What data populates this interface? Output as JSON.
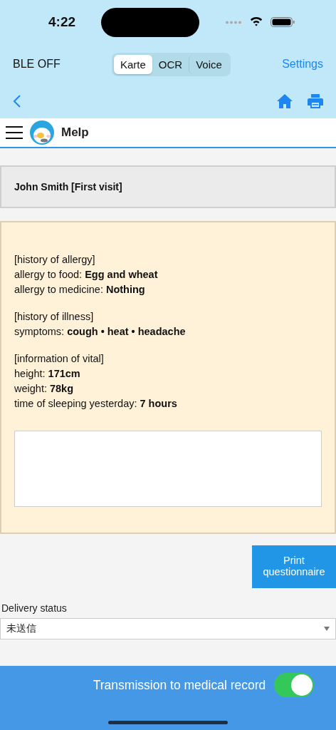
{
  "status_bar": {
    "time": "4:22"
  },
  "nav": {
    "ble_status": "BLE OFF",
    "segments": [
      {
        "label": "Karte",
        "selected": true
      },
      {
        "label": "OCR",
        "selected": false
      },
      {
        "label": "Voice",
        "selected": false
      }
    ],
    "settings": "Settings"
  },
  "header": {
    "app_name": "Melp"
  },
  "patient": {
    "title": "John Smith [First visit]"
  },
  "questionnaire": {
    "sections": [
      {
        "heading": "[history of allergy]",
        "lines": [
          {
            "label": "allergy to food: ",
            "value": "Egg and wheat"
          },
          {
            "label": "allergy to medicine: ",
            "value": "Nothing"
          }
        ]
      },
      {
        "heading": "[history of illness]",
        "lines": [
          {
            "label": "symptoms: ",
            "value": "cough • heat • headache"
          }
        ]
      },
      {
        "heading": "[information of vital]",
        "lines": [
          {
            "label": "height: ",
            "value": "171cm"
          },
          {
            "label": "weight: ",
            "value": "78kg"
          },
          {
            "label": "time of sleeping yesterday: ",
            "value": "7 hours"
          }
        ]
      }
    ]
  },
  "print_button": "Print questionnaire",
  "delivery": {
    "label": "Delivery status",
    "value": "未送信"
  },
  "bottom_bar": {
    "label": "Transmission to medical record",
    "on": true
  }
}
